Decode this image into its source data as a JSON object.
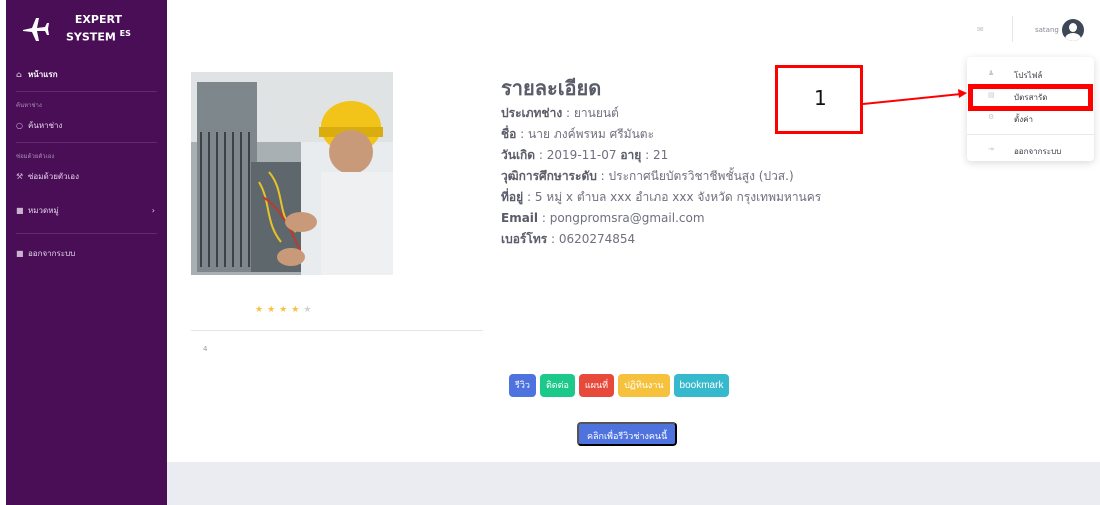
{
  "sidebar": {
    "brand_line1": "EXPERT",
    "brand_line2": "SYSTEM",
    "brand_sup": "ES",
    "home_label": "หน้าแรก",
    "heading_search": "ค้นหาช่าง",
    "search_label": "ค้นหาช่าง",
    "heading_repair": "ซ่อมด้วยตัวเอง",
    "repair_label": "ซ่อมด้วยตัวเอง",
    "category_label": "หมวดหมู่",
    "logout_label": "ออกจากระบบ"
  },
  "topbar": {
    "username": "satang"
  },
  "dropdown": {
    "items": [
      {
        "label": "โปรไฟล์",
        "icon": "user-icon"
      },
      {
        "label": "บัตรสารัด",
        "icon": "card-icon"
      },
      {
        "label": "ตั้งค่า",
        "icon": "settings-icon"
      },
      {
        "label": "ออกจากระบบ",
        "icon": "logout-icon"
      }
    ]
  },
  "profile": {
    "title": "รายละเอียด",
    "type_label": "ประเภทช่าง",
    "type_value": " : ยานยนต์",
    "name_label": "ชื่อ",
    "name_value": " : นาย ภงค์พรหม ศรีมันตะ",
    "birth_label": "วันเกิด",
    "birth_value": " : 2019-11-07 ",
    "age_label": "อายุ",
    "age_value": " : 21",
    "edu_label": "วุฒิการศึกษาระดับ",
    "edu_value": " : ประกาศนียบัตรวิชาชีพชั้นสูง (ปวส.)",
    "addr_label": "ที่อยู่",
    "addr_value": " : 5 หมู่ x ตำบล xxx อำเภอ xxx จังหวัด กรุงเทพมหานคร",
    "email_label": "Email",
    "email_value": " : pongpromsra@gmail.com",
    "phone_label": "เบอร์โทร",
    "phone_value": " : 0620274854",
    "rating_stars": 4,
    "rating_max": 5,
    "rating_number": "4"
  },
  "actions": {
    "review": "รีวิว",
    "contact": "ติดต่อ",
    "map": "แผนที่",
    "calendar": "ปฏิทินงาน",
    "bookmark": "bookmark",
    "review_this": "คลิกเพื่อรีวิวช่างคนนี้"
  },
  "annotation": {
    "number": "1",
    "color": "#ff0000"
  },
  "colors": {
    "sidebar": "#4a0e57",
    "primary": "#4e73df",
    "success": "#1cc88a",
    "danger": "#e74a3b",
    "warning": "#f6c23e",
    "info": "#36b9cc"
  }
}
